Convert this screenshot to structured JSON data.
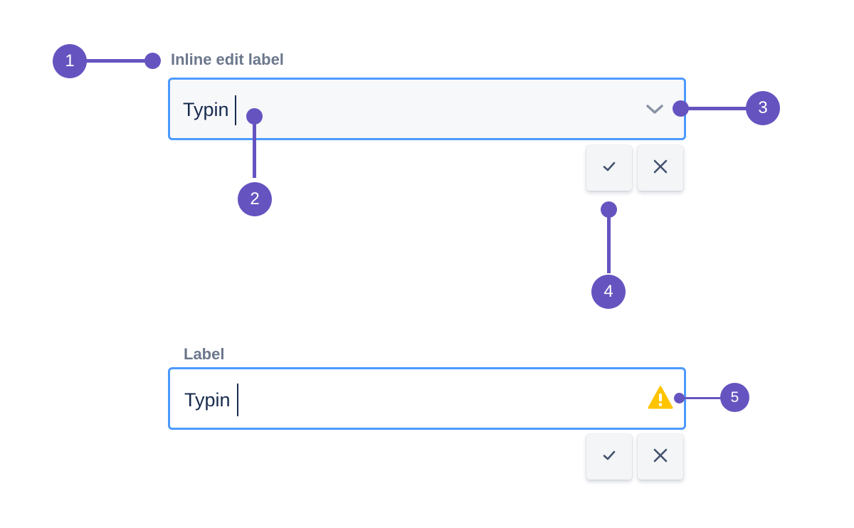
{
  "inline_edit": {
    "label": "Inline edit label",
    "value": "Typin",
    "field_icon": "chevron-down-icon",
    "confirm_icon": "check-icon",
    "cancel_icon": "close-icon"
  },
  "validation_edit": {
    "label": "Label",
    "value": "Typin",
    "field_icon": "warning-icon",
    "confirm_icon": "check-icon",
    "cancel_icon": "close-icon"
  },
  "callouts": [
    "1",
    "2",
    "3",
    "4",
    "5"
  ],
  "colors": {
    "callout": "#6554c0",
    "focus_border": "#4c9aff",
    "label": "#6b778c",
    "text": "#172b4d",
    "inline_field_bg": "#f7f8fa",
    "validation_field_bg": "#ffffff",
    "button_bg": "#f4f5f7",
    "warning": "#ffc400"
  }
}
